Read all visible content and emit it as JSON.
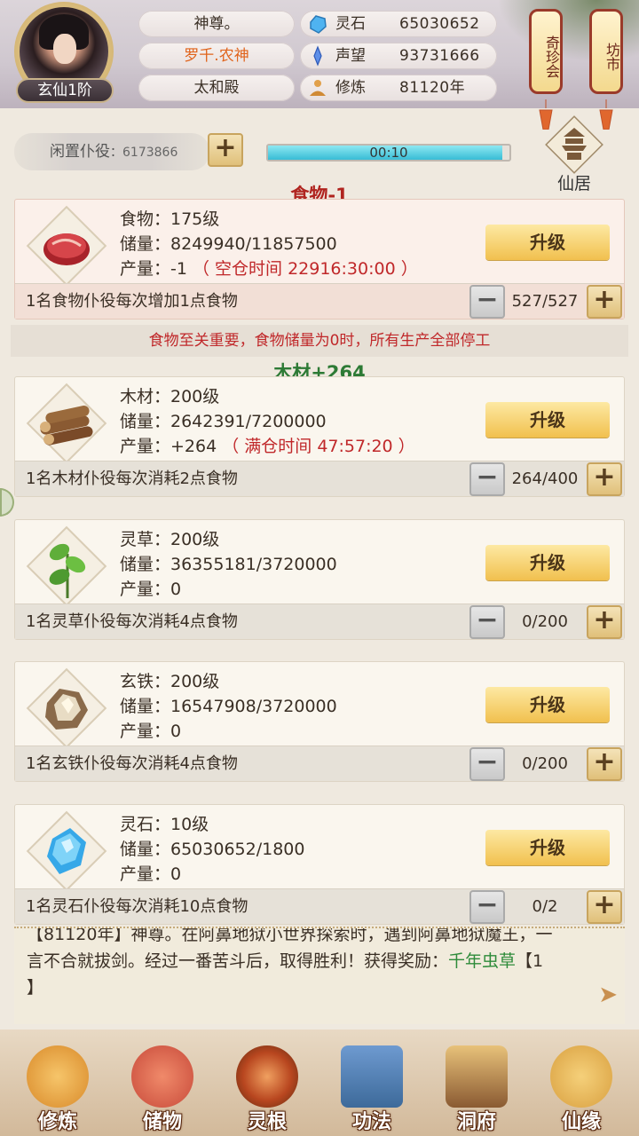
{
  "header": {
    "rank": "玄仙1阶",
    "title_pill": "神尊。",
    "name": "罗千.农神",
    "location": "太和殿",
    "stats": [
      {
        "label": "灵石",
        "value": "65030652",
        "icon": "spirit-stone-icon"
      },
      {
        "label": "声望",
        "value": "93731666",
        "icon": "prestige-icon"
      },
      {
        "label": "修炼",
        "value": "81120年",
        "icon": "cultivation-icon"
      }
    ],
    "lantern_left": "奇珍会",
    "lantern_right": "坊市"
  },
  "idle": {
    "label": "闲置仆役",
    "count": "6173866",
    "plus": "+"
  },
  "timer": {
    "text": "00:10",
    "progress": 0.97
  },
  "xianju": {
    "label": "仙居"
  },
  "sections": [
    {
      "title": "食物-1",
      "title_color": "#b0241f"
    },
    {
      "title": "木材+264",
      "title_color": "#2d7a35"
    }
  ],
  "warning": "食物至关重要，食物储量为0时，所有生产全部停工",
  "resources": [
    {
      "line1": "食物：175级",
      "line2": "储量：8249940/11857500",
      "line3": "产量：-1",
      "extra": "（ 空仓时间 22916:30:00 ）",
      "upgrade": "升级",
      "worker_text": "1名食物仆役每次增加1点食物",
      "count": "527/527",
      "icon": "meat-icon"
    },
    {
      "line1": "木材：200级",
      "line2": "储量：2642391/7200000",
      "line3": "产量：+264",
      "extra": "（ 满仓时间 47:57:20 ）",
      "upgrade": "升级",
      "worker_text": "1名木材仆役每次消耗2点食物",
      "count": "264/400",
      "icon": "wood-logs-icon"
    },
    {
      "line1": "灵草：200级",
      "line2": "储量：36355181/3720000",
      "line3": "产量：0",
      "extra": "",
      "upgrade": "升级",
      "worker_text": "1名灵草仆役每次消耗4点食物",
      "count": "0/200",
      "icon": "herb-icon"
    },
    {
      "line1": "玄铁：200级",
      "line2": "储量：16547908/3720000",
      "line3": "产量：0",
      "extra": "",
      "upgrade": "升级",
      "worker_text": "1名玄铁仆役每次消耗4点食物",
      "count": "0/200",
      "icon": "iron-ore-icon"
    },
    {
      "line1": "灵石：10级",
      "line2": "储量：65030652/1800",
      "line3": "产量：0",
      "extra": "",
      "upgrade": "升级",
      "worker_text": "1名灵石仆役每次消耗10点食物",
      "count": "0/2",
      "icon": "crystal-icon"
    }
  ],
  "log": {
    "line1": "【81120年】神尊。在阿鼻地狱小世界探索时，遇到阿鼻地狱魔王，一",
    "line2_a": "言不合就拔剑。经过一番苦斗后，取得胜利！获得奖励：",
    "line2_b": "千年虫草",
    "line2_c": "【1",
    "line3": "】"
  },
  "nav": [
    {
      "label": "修炼",
      "icon": "cultivate-icon",
      "color": "#d98a2a"
    },
    {
      "label": "储物",
      "icon": "storage-bag-icon",
      "color": "#c84a3a"
    },
    {
      "label": "灵根",
      "icon": "spirit-root-icon",
      "color": "#b8461f"
    },
    {
      "label": "功法",
      "icon": "scripture-icon",
      "color": "#3d6a9a"
    },
    {
      "label": "洞府",
      "icon": "cave-palace-icon",
      "color": "#c39445"
    },
    {
      "label": "仙缘",
      "icon": "fate-gourd-icon",
      "color": "#d9a040"
    }
  ]
}
